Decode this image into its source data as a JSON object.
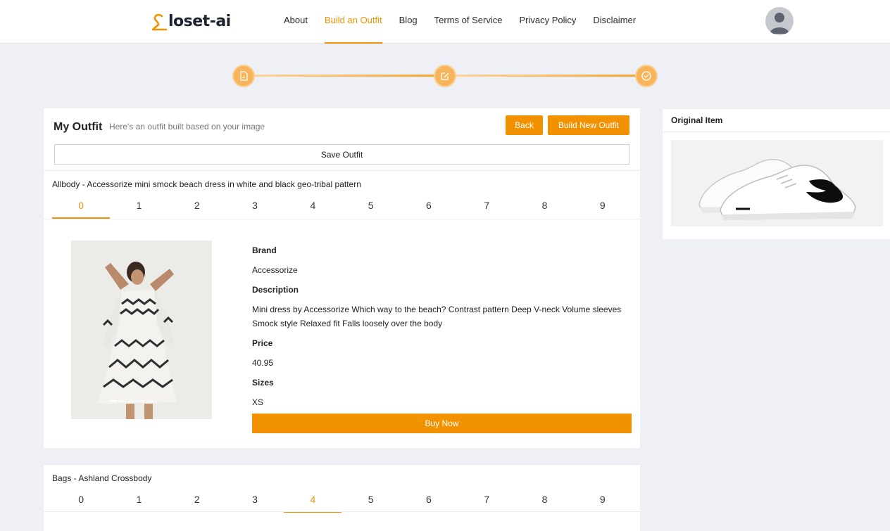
{
  "header": {
    "logo_text": "loset-ai",
    "nav": [
      {
        "label": "About",
        "active": false
      },
      {
        "label": "Build an Outfit",
        "active": true
      },
      {
        "label": "Blog",
        "active": false
      },
      {
        "label": "Terms of Service",
        "active": false
      },
      {
        "label": "Privacy Policy",
        "active": false
      },
      {
        "label": "Disclaimer",
        "active": false
      }
    ]
  },
  "stepper": {
    "steps": [
      {
        "icon": "document-image-icon"
      },
      {
        "icon": "edit-icon"
      },
      {
        "icon": "check-circle-icon"
      }
    ]
  },
  "outfit": {
    "title": "My Outfit",
    "subtitle": "Here's an outfit built based on your image",
    "back_label": "Back",
    "build_new_label": "Build New Outfit",
    "save_label": "Save Outfit"
  },
  "items": [
    {
      "title": "Allbody - Accessorize mini smock beach dress in white and black geo-tribal pattern",
      "tabs": [
        "0",
        "1",
        "2",
        "3",
        "4",
        "5",
        "6",
        "7",
        "8",
        "9"
      ],
      "active_tab": 0,
      "brand_label": "Brand",
      "brand": "Accessorize",
      "description_label": "Description",
      "description": "Mini dress by Accessorize Which way to the beach? Contrast pattern Deep V-neck Volume sleeves Smock style Relaxed fit Falls loosely over the body",
      "price_label": "Price",
      "price": "40.95",
      "sizes_label": "Sizes",
      "sizes": "XS",
      "buy_label": "Buy Now"
    },
    {
      "title": "Bags - Ashland Crossbody",
      "tabs": [
        "0",
        "1",
        "2",
        "3",
        "4",
        "5",
        "6",
        "7",
        "8",
        "9"
      ],
      "active_tab": 4
    }
  ],
  "original": {
    "title": "Original Item"
  },
  "colors": {
    "accent": "#f39200",
    "background": "#eef0f5"
  }
}
